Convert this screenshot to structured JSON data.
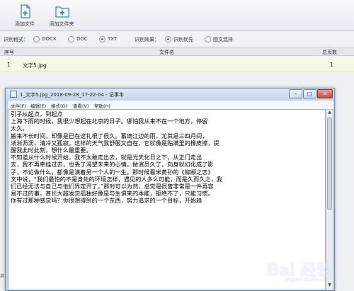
{
  "toolbar": {
    "add_file_label": "添加文件",
    "add_folder_label": "添加文件夹",
    "icons": [
      "add-file-icon",
      "add-folder-icon"
    ]
  },
  "options": {
    "format_label": "识别格式：",
    "formats": [
      {
        "label": "DOCX",
        "selected": false
      },
      {
        "label": "DOC",
        "selected": false
      },
      {
        "label": "TXT",
        "selected": true
      }
    ],
    "effect_label": "识别效果：",
    "effects": [
      {
        "label": "识别优先",
        "selected": true
      },
      {
        "label": "图文混排",
        "selected": false
      }
    ]
  },
  "table": {
    "headers": {
      "index": "序号",
      "filename": "文件名",
      "pages": "总页数"
    },
    "rows": [
      {
        "index": "1",
        "filename": "文字5.jpg",
        "pages": "1"
      }
    ]
  },
  "notepad": {
    "title": "1_文字5.jpg_2018-09-28_17-22-04 - 记事本",
    "menu": [
      "文件(F)",
      "编辑(E)",
      "格式(O)",
      "查看(V)",
      "帮助(H)"
    ],
    "buttons": {
      "minimize": "–",
      "maximize": "□",
      "close": "✕"
    },
    "content": "引子从起点，到起点\n上海下雨的时候，我很少想起在北京的日子。哪怕我从来不在一个地方，停留\n太久。\n搬来不长时间，却像是已在这扎根了很久。蓄谪江边的雨，尤其是三四月间，\n淅淅沥沥，清冷又孤寂。这样的天气我舒服又自在，它就像是贴满里的橡皮擦，提\n醒我此时此刻，想什么最重要。\n不知道从什么时候开始，我不太敢走出去，就是光天化日之下，从正门走出\n去，我不再牵挂过去，也丢了渴望未来的心情。做演员久了，向身就幻化成了影\n子，不论做什么，都像是演着另一个人的一生。那时候看米黄孙的《柳颛之恋》\n文中说，“我们最怕的不是身处的环境怎样，遇见的人多么可能，而是久而久之，我\n们已经无法与自己与他们界定开了。”那时可以为然，总觉是很曾非常是一件再容\n易不过的事，甚长大越发觉孤独好像是与生俱来的本能，拒绝不了，只能习惯。\n你有过那种感觉吗？你很想得到的一个东西，努力追求的一个目标，开始趋",
    "left_edge_text": "其"
  },
  "watermark": {
    "text": "Bai 经验",
    "sub": "jingyan.baidu.com"
  }
}
